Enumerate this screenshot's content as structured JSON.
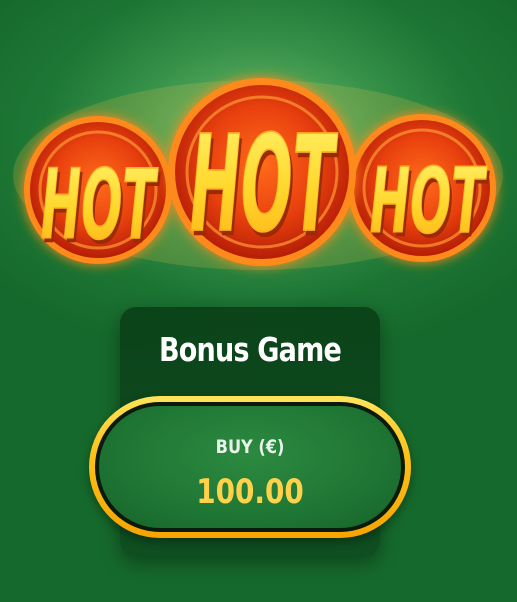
{
  "logo": {
    "words": [
      "HOT",
      "HOT",
      "HOT"
    ],
    "colors": {
      "disc_outer": "#c92a0a",
      "disc_inner": "#f25a14",
      "disc_ring": "#ff8a1e",
      "letter_fill": "#ffe23c",
      "letter_shadow": "#9a2b05"
    }
  },
  "bonus_panel": {
    "title": "Bonus Game",
    "buy_button": {
      "label": "BUY (€)",
      "amount": "100.00"
    }
  },
  "colors": {
    "background": "#1f7a36",
    "button_border": "#ffc21a",
    "amount_text": "#ffd24a"
  }
}
